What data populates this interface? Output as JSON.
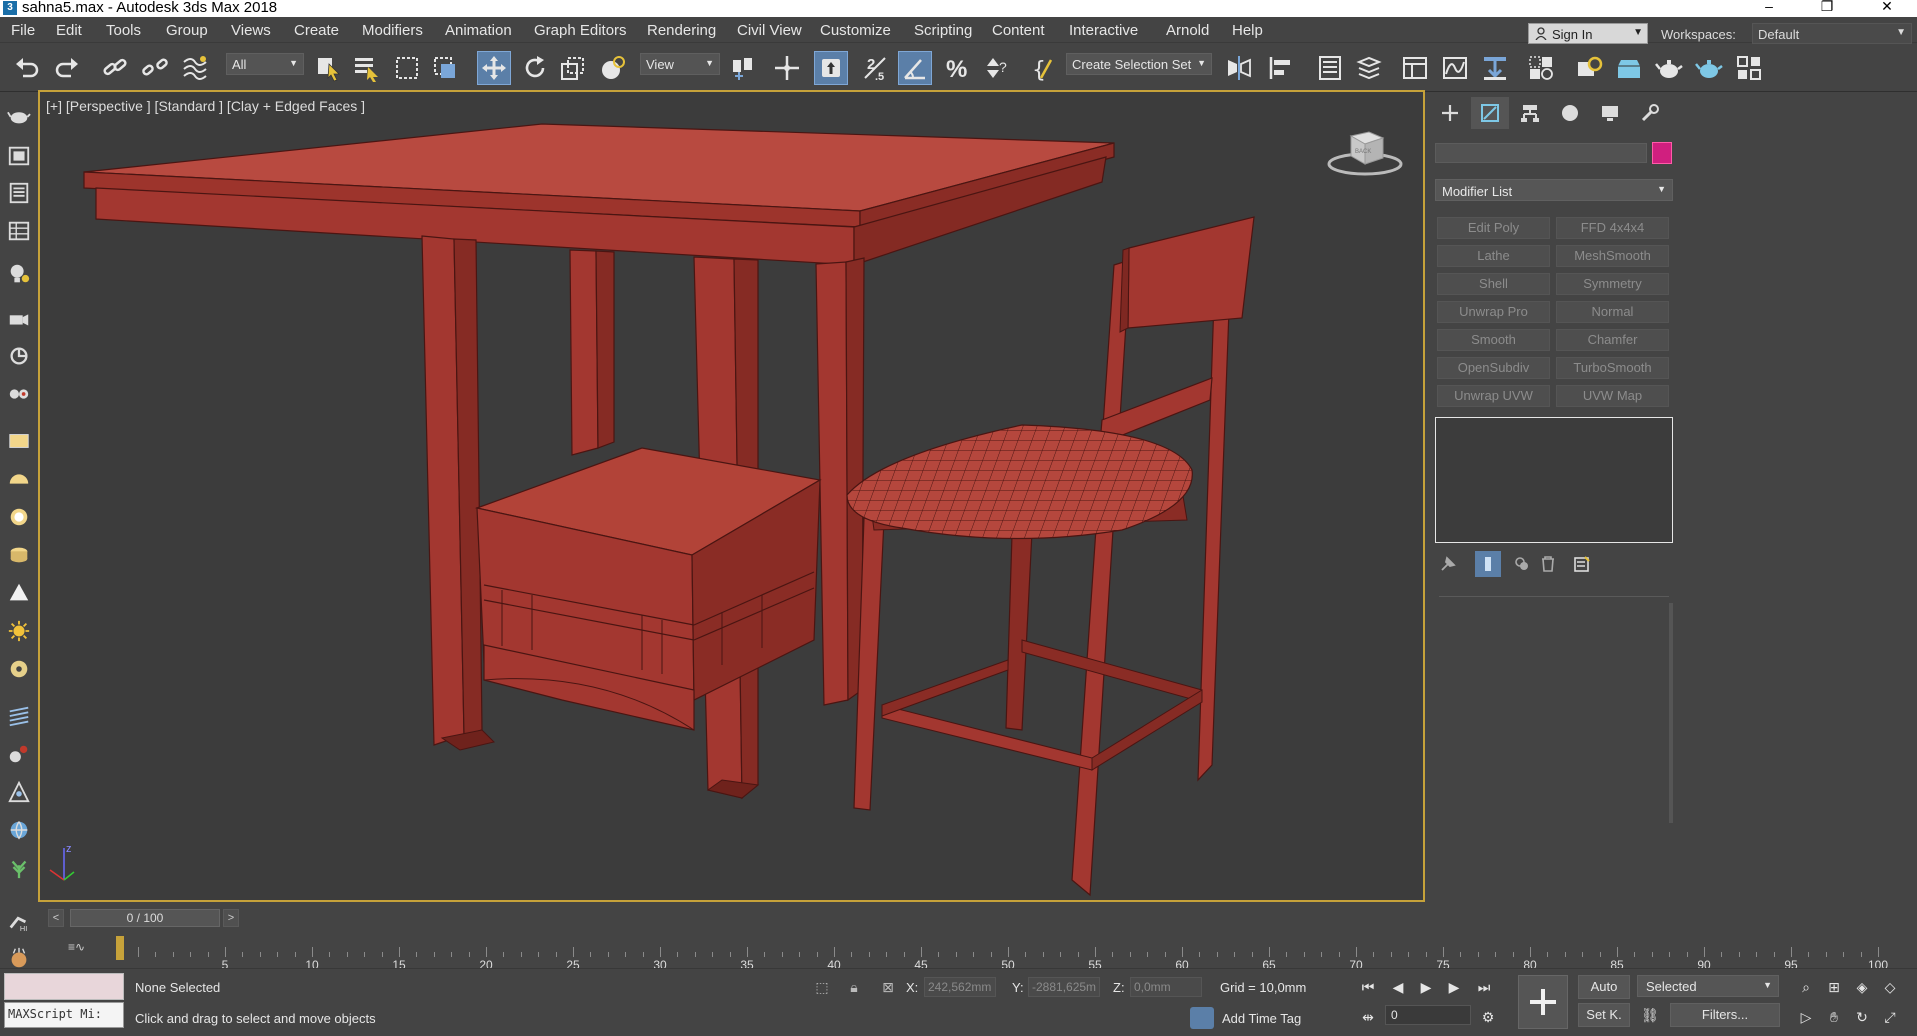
{
  "window": {
    "title": "sahna5.max - Autodesk 3ds Max 2018",
    "app_icon": "3",
    "minimize": "–",
    "restore": "❐",
    "close": "✕"
  },
  "menu": [
    "File",
    "Edit",
    "Tools",
    "Group",
    "Views",
    "Create",
    "Modifiers",
    "Animation",
    "Graph Editors",
    "Rendering",
    "Civil View",
    "Customize",
    "Scripting",
    "Content",
    "Interactive",
    "Arnold",
    "Help"
  ],
  "account": {
    "sign_in": "Sign In",
    "workspaces_label": "Workspaces:",
    "workspace": "Default"
  },
  "toolbar": {
    "selection_filter": "All",
    "ref_coord": "View",
    "named_selection": "Create Selection Set",
    "snap_label": "2.5"
  },
  "viewport": {
    "label": "[+] [Perspective ] [Standard ] [Clay + Edged Faces ]",
    "viewcube_face": "BACK"
  },
  "command_panel": {
    "object_color": "#d01f7f",
    "modifier_list": "Modifier List",
    "modifiers": [
      "Edit Poly",
      "FFD 4x4x4",
      "Lathe",
      "MeshSmooth",
      "Shell",
      "Symmetry",
      "Unwrap Pro",
      "Normal",
      "Smooth",
      "Chamfer",
      "OpenSubdiv",
      "TurboSmooth",
      "Unwrap UVW",
      "UVW Map"
    ]
  },
  "time": {
    "slider_label": "0 / 100",
    "ticks": [
      0,
      5,
      10,
      15,
      20,
      25,
      30,
      35,
      40,
      45,
      50,
      55,
      60,
      65,
      70,
      75,
      80,
      85,
      90,
      95,
      100
    ],
    "prev": "<",
    "next": ">"
  },
  "status": {
    "maxscript": "MAXScript Mi:",
    "selection": "None Selected",
    "prompt": "Click and drag to select and move objects",
    "x_label": "X:",
    "x_value": "242,562mm",
    "y_label": "Y:",
    "y_value": "-2881,625m",
    "z_label": "Z:",
    "z_value": "0,0mm",
    "grid": "Grid = 10,0mm",
    "add_time_tag": "Add Time Tag",
    "frame": "0",
    "auto_key": "Auto",
    "set_key": "Set K.",
    "key_filter": "Selected",
    "filters": "Filters..."
  },
  "colors": {
    "model_fill": "#a83a32",
    "model_edge": "#4a1512",
    "viewport_border": "#c6a23a",
    "active_tool": "#5b7fa8"
  }
}
